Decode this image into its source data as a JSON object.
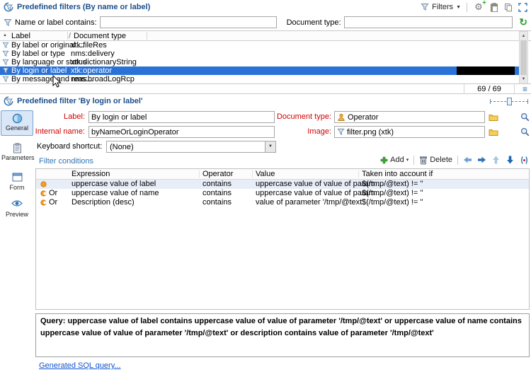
{
  "window": {
    "top_title": "Predefined filters (By name or label)",
    "detail_title": "Predefined filter 'By login or label'"
  },
  "toolbar": {
    "filters_label": "Filters"
  },
  "search": {
    "name_label": "Name or label contains:",
    "name_value": "",
    "doctype_label": "Document type:",
    "doctype_value": ""
  },
  "filter_list": {
    "columns": {
      "label": "Label",
      "doctype": "Document type"
    },
    "rows": [
      {
        "label": "By label or original ...",
        "doctype": "xtk:fileRes"
      },
      {
        "label": "By label or type",
        "doctype": "nms:delivery"
      },
      {
        "label": "By language or status",
        "doctype": "xtk:dictionaryString"
      },
      {
        "label": "By login or label",
        "doctype": "xtk:operator"
      },
      {
        "label": "By message and reas...",
        "doctype": "nms:broadLogRcp"
      }
    ],
    "count": "69 / 69"
  },
  "tabs": [
    {
      "label": "General"
    },
    {
      "label": "Parameters"
    },
    {
      "label": "Form"
    },
    {
      "label": "Preview"
    }
  ],
  "form": {
    "label_caption": "Label:",
    "label_value": "By login or label",
    "doctype_caption": "Document type:",
    "doctype_value": "Operator",
    "internal_caption": "Internal name:",
    "internal_value": "byNameOrLoginOperator",
    "image_caption": "Image:",
    "image_value": "filter.png (xtk)",
    "shortcut_caption": "Keyboard shortcut:",
    "shortcut_value": "(None)"
  },
  "conditions": {
    "title": "Filter conditions",
    "add_label": "Add",
    "delete_label": "Delete",
    "columns": {
      "expression": "Expression",
      "operator": "Operator",
      "value": "Value",
      "taken": "Taken into account if"
    },
    "rows": [
      {
        "join": "",
        "expression": "uppercase value of label",
        "operator": "contains",
        "value": "uppercase value of value of param...",
        "taken": "$(/tmp/@text) != ''"
      },
      {
        "join": "Or",
        "expression": "uppercase value of name",
        "operator": "contains",
        "value": "uppercase value of value of param...",
        "taken": "$(/tmp/@text) != ''"
      },
      {
        "join": "Or",
        "expression": "Description (desc)",
        "operator": "contains",
        "value": "value of parameter '/tmp/@text'",
        "taken": "$(/tmp/@text) != ''"
      }
    ]
  },
  "query": {
    "text": "Query: uppercase value of label contains uppercase value of value of parameter '/tmp/@text' or uppercase value of name contains uppercase value of value of parameter '/tmp/@text' or description contains value of parameter '/tmp/@text'",
    "sql_link": "Generated SQL query..."
  },
  "icons": {
    "gear": "⚙",
    "gear_plus": "+",
    "refresh": "↻",
    "caret_down": "▼",
    "caret_small": "▾",
    "sort_asc": "▲",
    "slash": "/",
    "menu": "≡",
    "scroll_up": "▲",
    "scroll_down": "▼"
  },
  "colors": {
    "selection_blue": "#2a72d8",
    "title_blue": "#1c4f8a",
    "mandatory_red": "#d40000",
    "link_blue": "#1155cc",
    "accent_green": "#2f9e2f",
    "condition_orange": "#f59d2c"
  }
}
